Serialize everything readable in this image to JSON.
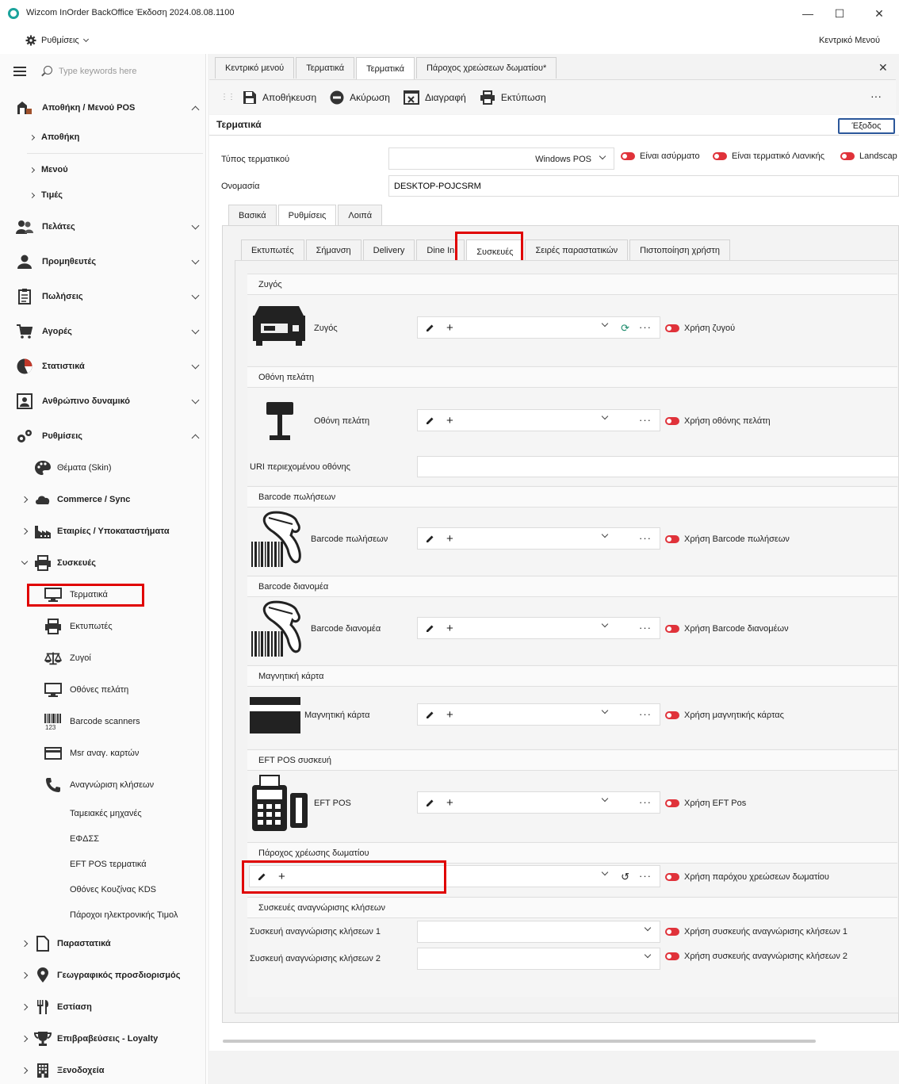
{
  "window": {
    "title": "Wizcom InOrder BackOffice Έκδοση 2024.08.08.1100",
    "minimize": "—",
    "maximize": "☐",
    "close": "✕"
  },
  "menubar": {
    "settings_label": "Ρυθμίσεις",
    "main_menu_label": "Κεντρικό Μενού"
  },
  "sidebar": {
    "search_placeholder": "Type keywords here",
    "top_items": [
      {
        "label": "Αποθήκη / Μενού POS"
      },
      {
        "label": "Αποθήκη"
      },
      {
        "label": "Μενού"
      },
      {
        "label": "Τιμές"
      },
      {
        "label": "Πελάτες"
      },
      {
        "label": "Προμηθευτές"
      },
      {
        "label": "Πωλήσεις"
      },
      {
        "label": "Αγορές"
      },
      {
        "label": "Στατιστικά"
      },
      {
        "label": "Ανθρώπινο δυναμικό"
      },
      {
        "label": "Ρυθμίσεις"
      }
    ],
    "settings_items": [
      {
        "label": "Θέματα (Skin)"
      },
      {
        "label": "Commerce / Sync"
      },
      {
        "label": "Εταιρίες / Υποκαταστήματα"
      },
      {
        "label": "Συσκευές"
      }
    ],
    "device_items": [
      {
        "label": "Τερματικά"
      },
      {
        "label": "Εκτυπωτές"
      },
      {
        "label": "Ζυγοί"
      },
      {
        "label": "Οθόνες πελάτη"
      },
      {
        "label": "Barcode scanners"
      },
      {
        "label": "Msr αναγ. καρτών"
      },
      {
        "label": "Αναγνώριση κλήσεων"
      },
      {
        "label": "Ταμειακές μηχανές"
      },
      {
        "label": "ΕΦΔΣΣ"
      },
      {
        "label": "EFT POS τερματικά"
      },
      {
        "label": "Οθόνες Κουζίνας KDS"
      },
      {
        "label": "Πάροχοι ηλεκτρονικής Τιμολ"
      }
    ],
    "bottom_items": [
      {
        "label": "Παραστατικά"
      },
      {
        "label": "Γεωγραφικός προσδιορισμός"
      },
      {
        "label": "Εστίαση"
      },
      {
        "label": "Επιβραβεύσεις - Loyalty"
      },
      {
        "label": "Ξενοδοχεία"
      }
    ]
  },
  "doc_tabs": [
    {
      "label": "Κεντρικό μενού"
    },
    {
      "label": "Τερματικά"
    },
    {
      "label": "Τερματικά"
    },
    {
      "label": "Πάροχος χρεώσεων δωματίου*"
    }
  ],
  "toolbar": {
    "save": "Αποθήκευση",
    "cancel": "Ακύρωση",
    "delete": "Διαγραφή",
    "print": "Εκτύπωση",
    "more": "···"
  },
  "form": {
    "section_title": "Τερματικά",
    "exit_label": "Έξοδος",
    "terminal_type_label": "Τύπος τερματικού",
    "terminal_type_value": "Windows POS",
    "toggles": {
      "wireless": "Είναι ασύρματο",
      "retail": "Είναι τερματικό Λιανικής",
      "landscape": "Landscap"
    },
    "name_label": "Ονομασία",
    "name_value": "DESKTOP-POJCSRM",
    "main_tabs": [
      {
        "label": "Βασικά"
      },
      {
        "label": "Ρυθμίσεις"
      },
      {
        "label": "Λοιπά"
      }
    ],
    "sub_tabs": [
      {
        "label": "Εκτυπωτές"
      },
      {
        "label": "Σήμανση"
      },
      {
        "label": "Delivery"
      },
      {
        "label": "Dine In"
      },
      {
        "label": "Συσκευές"
      },
      {
        "label": "Σειρές παραστατικών"
      },
      {
        "label": "Πιστοποίηση χρήστη"
      }
    ]
  },
  "devices": {
    "scale": {
      "header": "Ζυγός",
      "label": "Ζυγός",
      "toggle": "Χρήση ζυγού"
    },
    "customer_display": {
      "header": "Οθόνη πελάτη",
      "label": "Οθόνη πελάτη",
      "toggle": "Χρήση οθόνης πελάτη",
      "uri_label": "URI περιεχομένου οθόνης",
      "uri_value": ""
    },
    "barcode_sales": {
      "header": "Barcode πωλήσεων",
      "label": "Barcode πωλήσεων",
      "toggle": "Χρήση Barcode πωλήσεων"
    },
    "barcode_dist": {
      "header": "Barcode διανομέα",
      "label": "Barcode διανομέα",
      "toggle": "Χρήση Barcode διανομέων"
    },
    "magnetic": {
      "header": "Μαγνητική κάρτα",
      "label": "Μαγνητική κάρτα",
      "toggle": "Χρήση μαγνητικής κάρτας"
    },
    "eft": {
      "header": "EFT POS συσκευή",
      "label": "EFT POS",
      "toggle": "Χρήση EFT Pos"
    },
    "room_charge": {
      "header": "Πάροχος χρέωσης δωματίου",
      "toggle": "Χρήση παρόχου χρεώσεων δωματίου"
    },
    "call_id": {
      "header": "Συσκευές αναγνώρισης κλήσεων",
      "device1_label": "Συσκευή αναγνώρισης κλήσεων 1",
      "device1_toggle": "Χρήση συσκευής αναγνώρισης κλήσεων 1",
      "device2_label": "Συσκευή αναγνώρισης κλήσεων 2",
      "device2_toggle": "Χρήση συσκευής αναγνώρισης κλήσεων 2"
    }
  },
  "colors": {
    "accent": "#2b579a",
    "toggle_off": "#e0323a",
    "highlight": "#e00000",
    "teal": "#1ba39c"
  }
}
